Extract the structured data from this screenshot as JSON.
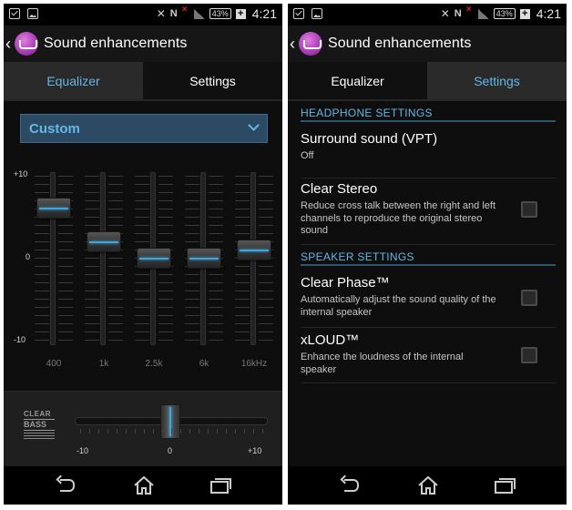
{
  "status_bar": {
    "battery": "43%",
    "time": "4:21"
  },
  "app": {
    "title": "Sound enhancements"
  },
  "tabs": {
    "equalizer": "Equalizer",
    "settings": "Settings"
  },
  "equalizer": {
    "preset": "Custom",
    "scale_top": "+10",
    "scale_mid": "0",
    "scale_bottom": "-10",
    "bands": [
      {
        "label": "400",
        "value": 6
      },
      {
        "label": "1k",
        "value": 2
      },
      {
        "label": "2.5k",
        "value": 0
      },
      {
        "label": "6k",
        "value": 0
      },
      {
        "label": "16kHz",
        "value": 1
      }
    ],
    "clear_bass": {
      "logo_top": "CLEAR",
      "logo_bottom": "BASS",
      "min_label": "-10",
      "mid_label": "0",
      "max_label": "+10",
      "value": 0
    }
  },
  "settings": {
    "headphone_header": "HEADPHONE SETTINGS",
    "surround": {
      "title": "Surround sound (VPT)",
      "value": "Off"
    },
    "clear_stereo": {
      "title": "Clear Stereo",
      "desc": "Reduce cross talk between the right and left channels to reproduce the original stereo sound",
      "checked": false
    },
    "speaker_header": "SPEAKER SETTINGS",
    "clear_phase": {
      "title": "Clear Phase™",
      "desc": "Automatically adjust the sound quality of the internal speaker",
      "checked": false
    },
    "xloud": {
      "title": "xLOUD™",
      "desc": "Enhance the loudness of the internal speaker",
      "checked": false
    }
  },
  "colors": {
    "accent": "#63b8e5",
    "slider_line": "#3fa6dc",
    "preset_bg": "#2c4a63"
  }
}
